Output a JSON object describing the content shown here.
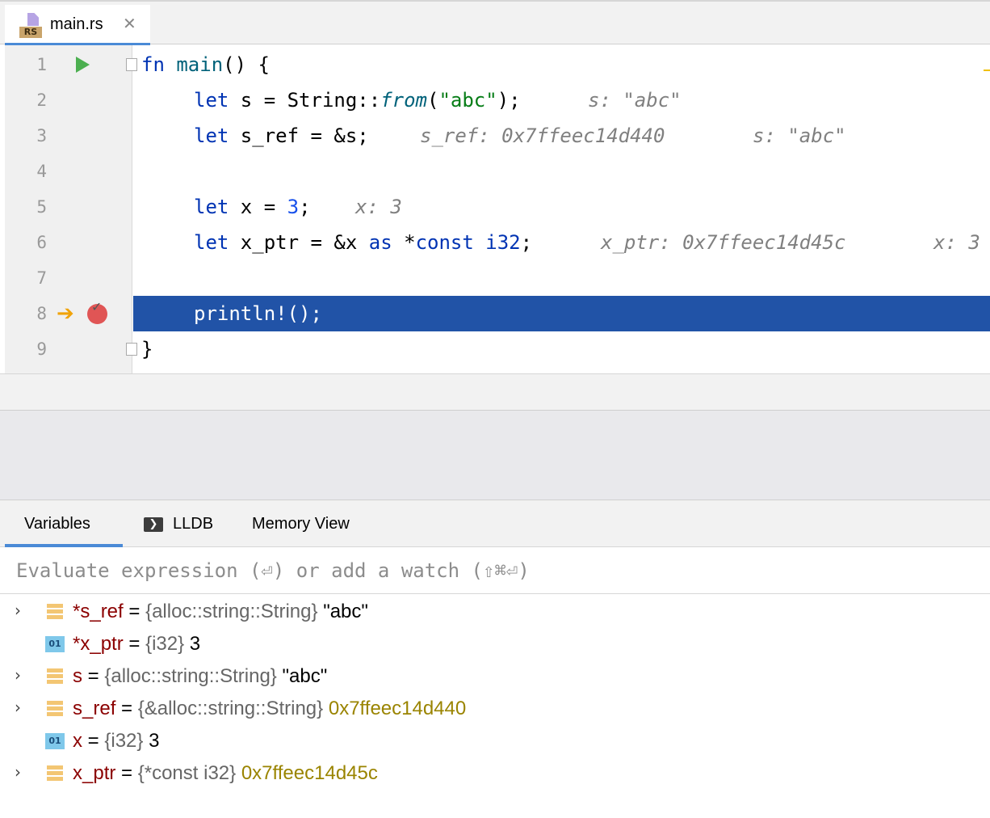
{
  "tab": {
    "title": "main.rs",
    "badge": "RS",
    "close": "✕"
  },
  "editor": {
    "lines": [
      {
        "n": "1"
      },
      {
        "n": "2"
      },
      {
        "n": "3"
      },
      {
        "n": "4"
      },
      {
        "n": "5"
      },
      {
        "n": "6"
      },
      {
        "n": "7"
      },
      {
        "n": "8"
      },
      {
        "n": "9"
      }
    ],
    "code": {
      "l1_fn": "fn",
      "l1_main": "main",
      "l1_rest": "() {",
      "l2_let": "let",
      "l2_a": " s = String::",
      "l2_from": "from",
      "l2_b": "(",
      "l2_str": "\"abc\"",
      "l2_c": ");",
      "l2_hint": "s: \"abc\"",
      "l3_let": "let",
      "l3_a": " s_ref = &s;",
      "l3_hint1": "s_ref: 0x7ffeec14d440",
      "l3_hint2": "s: \"abc\"",
      "l5_let": "let",
      "l5_a": " x = ",
      "l5_num": "3",
      "l5_b": ";",
      "l5_hint": "x: 3",
      "l6_let": "let",
      "l6_a": " x_ptr = &x ",
      "l6_as": "as",
      "l6_b": " *",
      "l6_const": "const",
      "l6_c": " ",
      "l6_i32": "i32",
      "l6_d": ";",
      "l6_hint1": "x_ptr: 0x7ffeec14d45c",
      "l6_hint2": "x: 3",
      "l8": "println!();",
      "l9": "}"
    }
  },
  "panel": {
    "tabs": [
      "Variables",
      "LLDB",
      "Memory View"
    ],
    "active_tab": "Variables",
    "eval_placeholder": "Evaluate expression (⏎) or add a watch (⇧⌘⏎)",
    "variables": [
      {
        "name": "*s_ref",
        "type": "{alloc::string::String}",
        "value": "\"abc\"",
        "icon": "struct-icon",
        "expandable": true
      },
      {
        "name": "*x_ptr",
        "type": "{i32}",
        "value": "3",
        "icon": "primitive-icon",
        "expandable": false
      },
      {
        "name": "s",
        "type": "{alloc::string::String}",
        "value": "\"abc\"",
        "icon": "struct-icon",
        "expandable": true
      },
      {
        "name": "s_ref",
        "type": "{&alloc::string::String}",
        "value": "0x7ffeec14d440",
        "icon": "struct-icon",
        "expandable": true
      },
      {
        "name": "x",
        "type": "{i32}",
        "value": "3",
        "icon": "primitive-icon",
        "expandable": false
      },
      {
        "name": "x_ptr",
        "type": "{*const i32}",
        "value": "0x7ffeec14d45c",
        "icon": "struct-icon",
        "expandable": true
      }
    ],
    "prim_badge": "01",
    "lldb_icon": "❯"
  },
  "colors": {
    "accent": "#4a8ad6",
    "current_line": "#2153a7",
    "breakpoint": "#e05555",
    "exec_arrow": "#f0a30a"
  }
}
